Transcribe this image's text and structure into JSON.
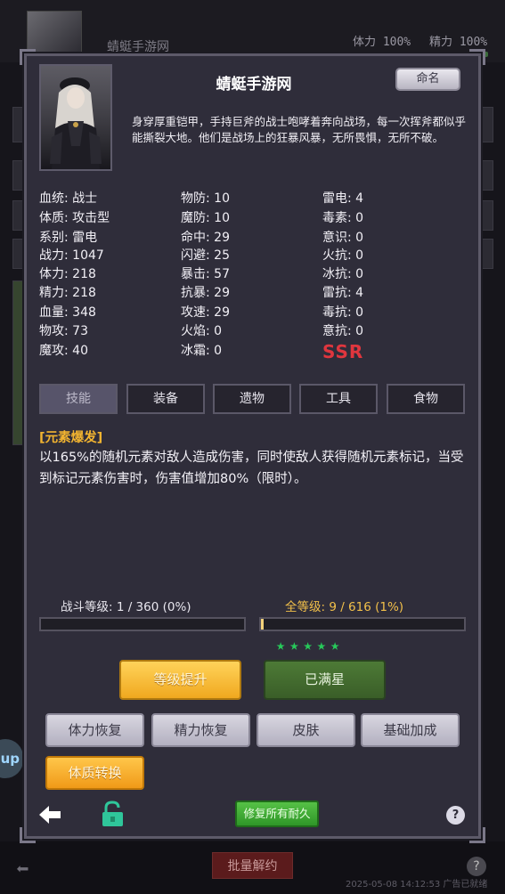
{
  "background": {
    "player_name": "蜻蜓手游网",
    "stamina": "体力 100%",
    "energy": "精力 100%",
    "up_badge": "up",
    "bulk_button": "批量解约",
    "timestamp": "2025-05-08 14:12:53 广告已就绪"
  },
  "panel": {
    "title": "蜻蜓手游网",
    "rename_button": "命名",
    "description": "身穿厚重铠甲，手持巨斧的战士咆哮着奔向战场，每一次挥斧都似乎能撕裂大地。他们是战场上的狂暴风暴，无所畏惧，无所不破。",
    "rarity": "SSR",
    "stats_col1": [
      "血统: 战士",
      "体质: 攻击型",
      "系别: 雷电",
      "战力: 1047",
      "体力: 218",
      "精力: 218",
      "血量: 348",
      "物攻: 73",
      "魔攻: 40"
    ],
    "stats_col2": [
      "物防: 10",
      "魔防: 10",
      "命中: 29",
      "闪避: 25",
      "暴击: 57",
      "抗暴: 29",
      "攻速: 29",
      "火焰: 0",
      "冰霜: 0"
    ],
    "stats_col3": [
      "雷电: 4",
      "毒素: 0",
      "意识: 0",
      "火抗: 0",
      "冰抗: 0",
      "雷抗: 4",
      "毒抗: 0",
      "意抗: 0"
    ],
    "tabs": [
      "技能",
      "装备",
      "遗物",
      "工具",
      "食物"
    ],
    "skill": {
      "name": "[元素爆发]",
      "text": "以165%的随机元素对敌人造成伤害，同时使敌人获得随机元素标记，当受到标记元素伤害时，伤害值增加80%（限时）。"
    },
    "combat_level": {
      "label": "战斗等级: 1 / 360 (0%)",
      "progress": 0.0
    },
    "total_level": {
      "label": "全等级: 9 / 616 (1%)",
      "progress": 0.015
    },
    "stars": "★★★★★",
    "buttons": {
      "level_up": "等级提升",
      "max_star": "已满星",
      "recover_stamina": "体力恢复",
      "recover_energy": "精力恢复",
      "skin": "皮肤",
      "base_bonus": "基础加成",
      "constitution_convert": "体质转换",
      "repair_all": "修复所有耐久"
    },
    "help": "?"
  },
  "colors": {
    "panel": "#2f2d3a",
    "gold": "#f2b430",
    "ssr": "#e0363e",
    "green_star": "#27c95a"
  }
}
